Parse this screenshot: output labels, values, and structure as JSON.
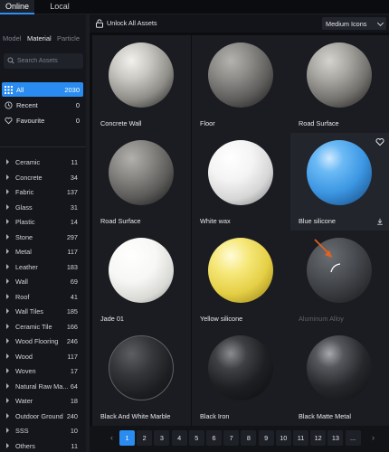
{
  "top_tabs": [
    {
      "label": "Online",
      "active": true
    },
    {
      "label": "Local",
      "active": false
    }
  ],
  "sidebar": {
    "subtabs": [
      {
        "label": "Model",
        "active": false
      },
      {
        "label": "Material",
        "active": true
      },
      {
        "label": "Particle",
        "active": false
      }
    ],
    "search_placeholder": "Search Assets",
    "filters": [
      {
        "label": "All",
        "count": "2030",
        "icon": "grid-icon",
        "active": true
      },
      {
        "label": "Recent",
        "count": "0",
        "icon": "clock-icon",
        "active": false
      },
      {
        "label": "Favourite",
        "count": "0",
        "icon": "heart-icon",
        "active": false
      }
    ],
    "categories": [
      {
        "label": "Ceramic",
        "count": "11"
      },
      {
        "label": "Concrete",
        "count": "34"
      },
      {
        "label": "Fabric",
        "count": "137"
      },
      {
        "label": "Glass",
        "count": "31"
      },
      {
        "label": "Plastic",
        "count": "14"
      },
      {
        "label": "Stone",
        "count": "297"
      },
      {
        "label": "Metal",
        "count": "117"
      },
      {
        "label": "Leather",
        "count": "183"
      },
      {
        "label": "Wall",
        "count": "69"
      },
      {
        "label": "Roof",
        "count": "41"
      },
      {
        "label": "Wall Tiles",
        "count": "185"
      },
      {
        "label": "Ceramic Tile",
        "count": "166"
      },
      {
        "label": "Wood Flooring",
        "count": "246"
      },
      {
        "label": "Wood",
        "count": "117"
      },
      {
        "label": "Woven",
        "count": "17"
      },
      {
        "label": "Natural Raw Ma...",
        "count": "64"
      },
      {
        "label": "Water",
        "count": "18"
      },
      {
        "label": "Outdoor Ground",
        "count": "240"
      },
      {
        "label": "SSS",
        "count": "10"
      },
      {
        "label": "Others",
        "count": "11"
      }
    ]
  },
  "toolbar": {
    "unlock_label": "Unlock All Assets",
    "view_mode": "Medium Icons"
  },
  "assets": [
    {
      "label": "Concrete Wall",
      "ball": "concrete",
      "dim": false
    },
    {
      "label": "Floor",
      "ball": "floor",
      "dim": false
    },
    {
      "label": "Road Surface",
      "ball": "road1",
      "dim": false
    },
    {
      "label": "Road Surface",
      "ball": "road2",
      "dim": false
    },
    {
      "label": "White wax",
      "ball": "wax",
      "dim": false
    },
    {
      "label": "Blue silicone",
      "ball": "blue",
      "dim": false,
      "hover": true
    },
    {
      "label": "Jade 01",
      "ball": "jade",
      "dim": false
    },
    {
      "label": "Yellow silicone",
      "ball": "yellow",
      "dim": false
    },
    {
      "label": "Aluminum Alloy",
      "ball": "alu",
      "dim": true
    },
    {
      "label": "Black And White Marble",
      "ball": "marble",
      "dim": false
    },
    {
      "label": "Black Iron",
      "ball": "iron",
      "dim": false
    },
    {
      "label": "Black Matte Metal",
      "ball": "metal",
      "dim": false
    }
  ],
  "pagination": {
    "prev": "‹",
    "next": "›",
    "pages": [
      "1",
      "2",
      "3",
      "4",
      "5",
      "6",
      "7",
      "8",
      "9",
      "10",
      "11",
      "12",
      "13",
      "..."
    ],
    "current": "1"
  },
  "colors": {
    "accent": "#2a8cf0",
    "annotation_arrow": "#e8621d"
  }
}
